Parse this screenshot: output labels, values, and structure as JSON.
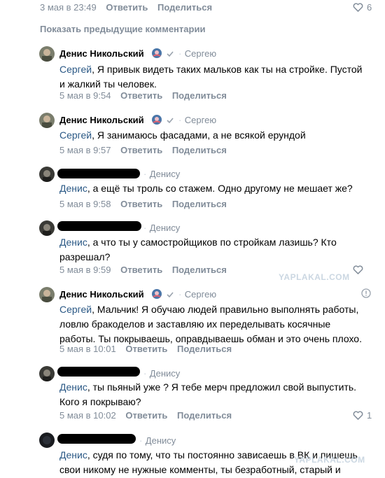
{
  "top": {
    "date": "3 мая в 23:49",
    "reply": "Ответить",
    "share": "Поделиться",
    "likes": "6"
  },
  "show_previous": "Показать предыдущие комментарии",
  "comments": [
    {
      "author": "Денис Никольский",
      "reply_to": "Сергею",
      "mention": "Сергей",
      "text": ", Я привык видеть таких мальков как ты на стройке. Пустой",
      "text2": "и жалкий ты человек.",
      "date": "5 мая в 9:54",
      "reply": "Ответить",
      "share": "Поделиться"
    },
    {
      "author": "Денис Никольский",
      "reply_to": "Сергею",
      "mention": "Сергей",
      "text": ", Я занимаюсь фасадами, а не всякой ерундой",
      "date": "5 мая в 9:57",
      "reply": "Ответить",
      "share": "Поделиться"
    },
    {
      "reply_to": "Денису",
      "mention": "Денис",
      "text": ", а ещё ты троль со стажем. Одно другому не мешает же?",
      "date": "5 мая в 9:58",
      "reply": "Ответить",
      "share": "Поделиться"
    },
    {
      "reply_to": "Денису",
      "mention": "Денис",
      "text": ", а что ты у самостройщиков по стройкам лазишь? Кто",
      "text2": "разрешал?",
      "date": "5 мая в 9:59",
      "reply": "Ответить",
      "share": "Поделиться"
    },
    {
      "author": "Денис Никольский",
      "reply_to": "Сергею",
      "mention": "Сергей",
      "text": ", Мальчик! Я обучаю людей правильно выполнять работы,",
      "text2": "ловлю бракоделов и заставляю их переделывать косячные",
      "text3": "работы. Ты покрываешь, оправдываешь обман и это очень плохо.",
      "date": "5 мая в 10:01",
      "reply": "Ответить",
      "share": "Поделиться"
    },
    {
      "reply_to": "Денису",
      "mention": "Денис",
      "text": ", ты пьяный уже ? Я тебе мерч предложил свой выпустить.",
      "text2": "Кого я покрываю?",
      "date": "5 мая в 10:02",
      "reply": "Ответить",
      "share": "Поделиться",
      "likes": "1"
    },
    {
      "reply_to": "Денису",
      "mention": "Денис",
      "text": ", судя по тому, что ты постоянно зависаешь в ВК и пишешь",
      "text2": "свои никому не нужные комменты, ты безработный, старый и"
    }
  ],
  "watermark": "YAPLAKAL.COM",
  "icons": {
    "like": "heart-icon",
    "verified": "verified-badge-icon",
    "check": "checkmark-icon",
    "info": "info-icon"
  },
  "colors": {
    "mention": "#2a5885",
    "meta": "#818c99"
  }
}
